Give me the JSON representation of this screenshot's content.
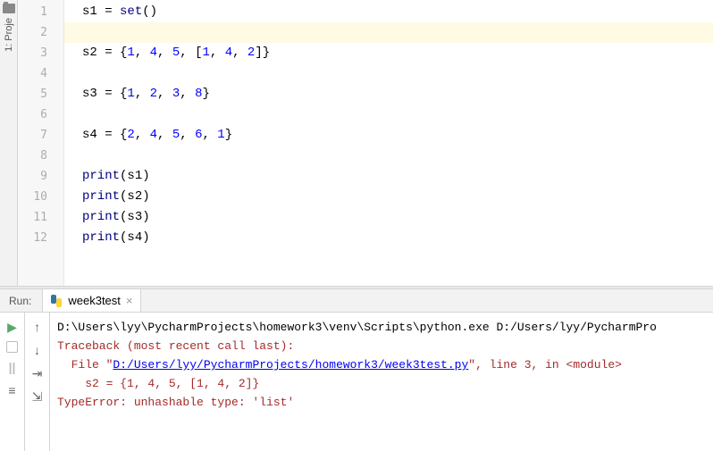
{
  "sidebar": {
    "project_label": "1: Proje"
  },
  "editor": {
    "lines": [
      "1",
      "2",
      "3",
      "4",
      "5",
      "6",
      "7",
      "8",
      "9",
      "10",
      "11",
      "12"
    ],
    "code": {
      "l1_a": "s1 = ",
      "l1_fn": "set",
      "l1_b": "()",
      "l3_a": "s2 = {",
      "l3_n1": "1",
      "l3_c1": ", ",
      "l3_n2": "4",
      "l3_c2": ", ",
      "l3_n3": "5",
      "l3_c3": ", [",
      "l3_n4": "1",
      "l3_c4": ", ",
      "l3_n5": "4",
      "l3_c5": ", ",
      "l3_n6": "2",
      "l3_c6": "]}",
      "l5_a": "s3 = {",
      "l5_n1": "1",
      "l5_c1": ", ",
      "l5_n2": "2",
      "l5_c2": ", ",
      "l5_n3": "3",
      "l5_c3": ", ",
      "l5_n4": "8",
      "l5_c4": "}",
      "l7_a": "s4 = {",
      "l7_n1": "2",
      "l7_c1": ", ",
      "l7_n2": "4",
      "l7_c2": ", ",
      "l7_n3": "5",
      "l7_c3": ", ",
      "l7_n4": "6",
      "l7_c4": ", ",
      "l7_n5": "1",
      "l7_c5": "}",
      "l9": "print",
      "l9b": "(s1)",
      "l10": "print",
      "l10b": "(s2)",
      "l11": "print",
      "l11b": "(s3)",
      "l12": "print",
      "l12b": "(s4)"
    }
  },
  "run": {
    "label": "Run:",
    "tab_name": "week3test",
    "console": {
      "cmd": "D:\\Users\\lyy\\PycharmProjects\\homework3\\venv\\Scripts\\python.exe D:/Users/lyy/PycharmPro",
      "trace": "Traceback (most recent call last):",
      "file_pre": "  File \"",
      "file_link": "D:/Users/lyy/PycharmProjects/homework3/week3test.py",
      "file_post": "\", line 3, in <module>",
      "src": "    s2 = {1, 4, 5, [1, 4, 2]}",
      "err": "TypeError: unhashable type: 'list'"
    }
  }
}
